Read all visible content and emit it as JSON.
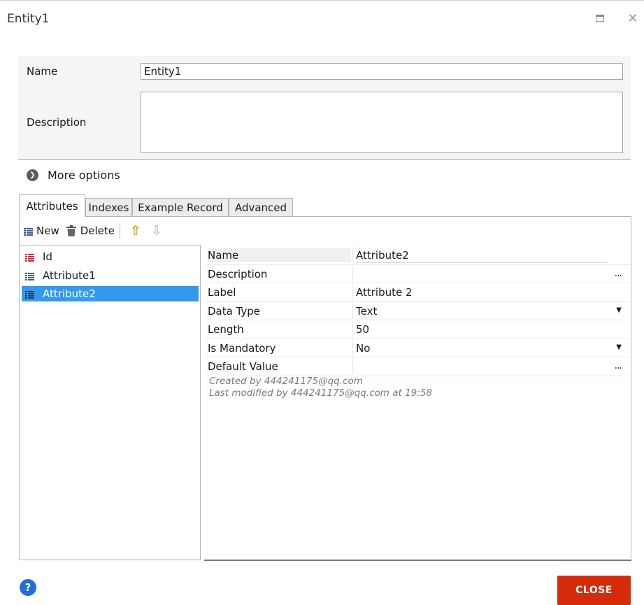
{
  "window": {
    "title": "Entity1",
    "maximize_icon": "maximize-icon",
    "close_icon": "close-icon",
    "close_glyph": "✕"
  },
  "form": {
    "name_label": "Name",
    "name_value": "Entity1",
    "description_label": "Description",
    "description_value": ""
  },
  "more_options": {
    "label": "More options",
    "icon": "chevron-right-circle-icon",
    "glyph": "❯"
  },
  "tabs": [
    {
      "label": "Attributes",
      "active": true
    },
    {
      "label": "Indexes",
      "active": false
    },
    {
      "label": "Example Record",
      "active": false
    },
    {
      "label": "Advanced",
      "active": false
    }
  ],
  "toolbar": {
    "new_label": "New",
    "delete_label": "Delete",
    "move_up_icon": "arrow-up-icon",
    "move_down_icon": "arrow-down-icon",
    "up_glyph": "⇧",
    "down_glyph": "⇩"
  },
  "attributes": [
    {
      "label": "Id",
      "icon": "key-grid-icon",
      "selected": false
    },
    {
      "label": "Attribute1",
      "icon": "grid-icon",
      "selected": false
    },
    {
      "label": "Attribute2",
      "icon": "grid-icon",
      "selected": true
    }
  ],
  "properties": [
    {
      "name": "Name",
      "value": "Attribute2",
      "editor": "text"
    },
    {
      "name": "Description",
      "value": "",
      "editor": "ellipsis"
    },
    {
      "name": "Label",
      "value": "Attribute 2",
      "editor": "text"
    },
    {
      "name": "Data Type",
      "value": "Text",
      "editor": "dropdown"
    },
    {
      "name": "Length",
      "value": "50",
      "editor": "text"
    },
    {
      "name": "Is Mandatory",
      "value": "No",
      "editor": "dropdown"
    },
    {
      "name": "Default Value",
      "value": "",
      "editor": "ellipsis"
    }
  ],
  "glyphs": {
    "ellipsis": "...",
    "dropdown": "▼"
  },
  "meta": {
    "created": "Created by 444241175@qq.com",
    "modified": "Last modified by 444241175@qq.com at 19:58"
  },
  "footer": {
    "help_glyph": "?",
    "close_label": "CLOSE"
  },
  "colors": {
    "selection": "#3399ee",
    "close_button": "#d52b0b",
    "help_icon": "#1f6fd6",
    "key_icon_red": "#d9262b",
    "grid_icon_blue": "#3d5a8a"
  }
}
